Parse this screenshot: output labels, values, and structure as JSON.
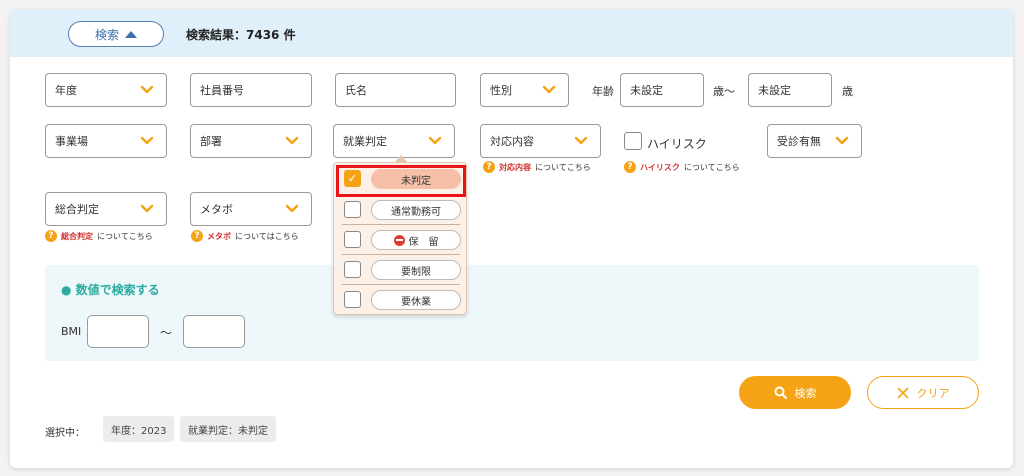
{
  "header": {
    "toggle_label": "検索",
    "result_text": "検索結果：7436 件"
  },
  "filters": {
    "nendo": "年度",
    "shain_placeholder": "社員番号",
    "shimei_placeholder": "氏名",
    "seibetsu": "性別",
    "nenrei_label": "年齢",
    "age_from_placeholder": "未設定",
    "age_sep": "歳〜",
    "age_to_placeholder": "未設定",
    "age_suffix": "歳",
    "jigyoujou": "事業場",
    "busho": "部署",
    "shugyo": "就業判定",
    "taiou": "対応内容",
    "highrisk": "ハイリスク",
    "jushin": "受診有無",
    "sougou": "総合判定",
    "metabo": "メタボ"
  },
  "help": {
    "taiou": {
      "key": "対応内容",
      "rest": "についてこちら"
    },
    "highrisk": {
      "key": "ハイリスク",
      "rest": "についてこちら"
    },
    "sougou": {
      "key": "総合判定",
      "rest": "についてこちら"
    },
    "metabo": {
      "key": "メタボ",
      "rest": "についてはこちら"
    },
    "icon": "?"
  },
  "dropdown": {
    "options": [
      {
        "label": "未判定",
        "checked": true
      },
      {
        "label": "通常勤務可",
        "checked": false
      },
      {
        "label": "保　留",
        "checked": false,
        "icon": "no-entry-icon"
      },
      {
        "label": "要制限",
        "checked": false
      },
      {
        "label": "要休業",
        "checked": false
      }
    ]
  },
  "numeric": {
    "title": "● 数値で検索する",
    "bmi_label": "BMI",
    "range_sep": "〜"
  },
  "actions": {
    "search_label": "検索",
    "clear_label": "クリア"
  },
  "selection": {
    "label": "選択中：",
    "chips": [
      "年度：2023",
      "就業判定：未判定"
    ]
  },
  "colors": {
    "accent": "#f5a214",
    "header_bg": "#dff0fb",
    "teal": "#2eaba0",
    "highlight": "#e8141a"
  }
}
